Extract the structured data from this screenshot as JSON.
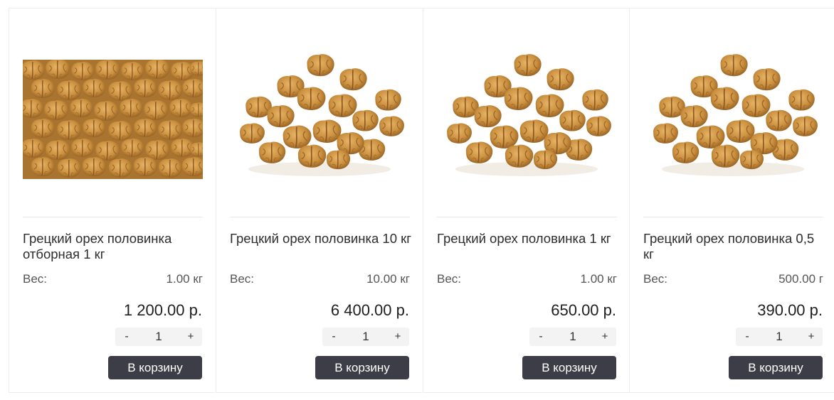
{
  "products": [
    {
      "title": "Грецкий орех половинка отборная 1 кг",
      "weight_label": "Вес:",
      "weight_value": "1.00 кг",
      "price": "1 200.00 р.",
      "qty": "1",
      "minus": "-",
      "plus": "+",
      "cart_label": "В корзину",
      "image": "walnut-halves-closeup"
    },
    {
      "title": "Грецкий орех половинка 10 кг",
      "weight_label": "Вес:",
      "weight_value": "10.00 кг",
      "price": "6 400.00 р.",
      "qty": "1",
      "minus": "-",
      "plus": "+",
      "cart_label": "В корзину",
      "image": "walnut-halves-pile"
    },
    {
      "title": "Грецкий орех половинка 1 кг",
      "weight_label": "Вес:",
      "weight_value": "1.00 кг",
      "price": "650.00 р.",
      "qty": "1",
      "minus": "-",
      "plus": "+",
      "cart_label": "В корзину",
      "image": "walnut-halves-pile"
    },
    {
      "title": "Грецкий орех половинка 0,5 кг",
      "weight_label": "Вес:",
      "weight_value": "500.00 г",
      "price": "390.00 р.",
      "qty": "1",
      "minus": "-",
      "plus": "+",
      "cart_label": "В корзину",
      "image": "walnut-halves-pile"
    }
  ],
  "colors": {
    "button_bg": "#3d3d48",
    "walnut": "#c98f3e"
  }
}
